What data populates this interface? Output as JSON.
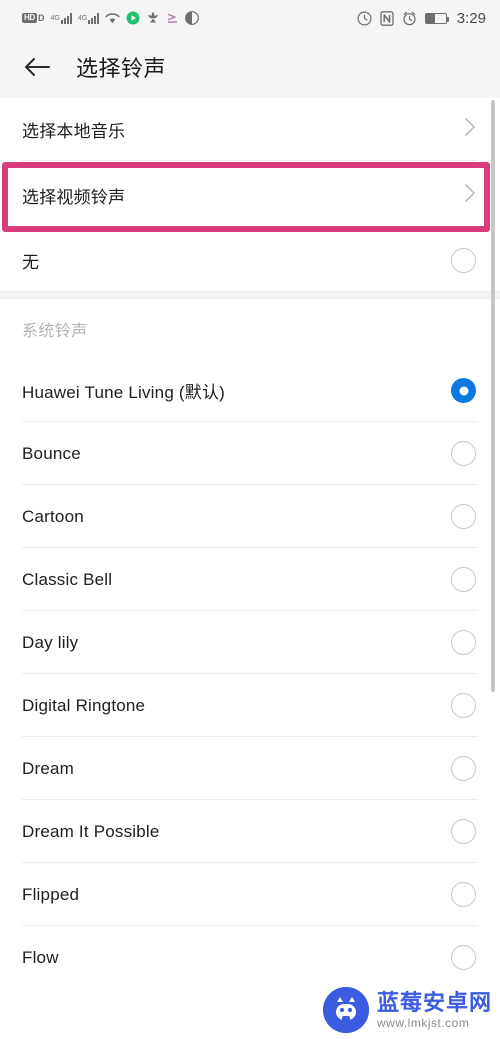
{
  "statusbar": {
    "hd_badge": "HD",
    "hd_suffix": "D",
    "network_label_1": "4G",
    "network_label_2": "4G",
    "icons": [
      "hd-volte-icon",
      "signal-4g-icon",
      "signal-4g-icon-2",
      "wifi-icon",
      "app-green-icon",
      "huawei-flower-icon",
      "share-icon",
      "hifi-icon"
    ],
    "right_icons": [
      "do-not-disturb-icon",
      "nfc-icon",
      "alarm-icon",
      "battery-icon"
    ],
    "time": "3:29"
  },
  "header": {
    "back_icon": "back-arrow-icon",
    "title": "选择铃声"
  },
  "top_actions": [
    {
      "label": "选择本地音乐",
      "accessory": "chevron-right-icon"
    },
    {
      "label": "选择视频铃声",
      "accessory": "chevron-right-icon",
      "highlighted": true
    }
  ],
  "none_row": {
    "label": "无",
    "selected": false
  },
  "section": {
    "title": "系统铃声"
  },
  "ringtones": [
    {
      "label": "Huawei Tune Living (默认)",
      "selected": true
    },
    {
      "label": "Bounce",
      "selected": false
    },
    {
      "label": "Cartoon",
      "selected": false
    },
    {
      "label": "Classic Bell",
      "selected": false
    },
    {
      "label": "Day lily",
      "selected": false
    },
    {
      "label": "Digital Ringtone",
      "selected": false
    },
    {
      "label": "Dream",
      "selected": false
    },
    {
      "label": "Dream It Possible",
      "selected": false
    },
    {
      "label": "Flipped",
      "selected": false
    },
    {
      "label": "Flow",
      "selected": false
    }
  ],
  "watermark": {
    "site_name": "蓝莓安卓网",
    "url": "www.lmkjst.com"
  },
  "colors": {
    "highlight_pink": "#d83e7d",
    "radio_selected_blue": "#0b7ae0",
    "watermark_blue": "#3b5be0",
    "header_bg": "#f5f5f5",
    "separator": "#ececec"
  }
}
